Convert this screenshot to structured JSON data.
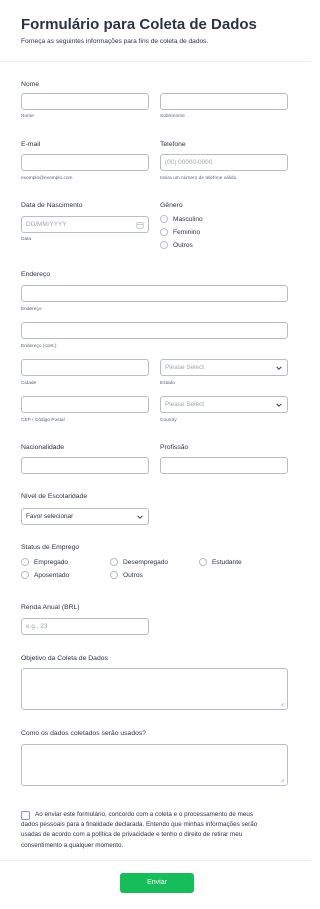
{
  "header": {
    "title": "Formulário para Coleta de Dados",
    "subtitle": "Forneça as seguintes informações para fins de coleta de dados."
  },
  "nome": {
    "label": "Nome",
    "first_sublabel": "Nome",
    "last_sublabel": "Sobrenome"
  },
  "email": {
    "label": "E-mail",
    "sublabel": "exemplo@exemplo.com"
  },
  "telefone": {
    "label": "Telefone",
    "placeholder": "(00) 00000-0000",
    "sublabel": "Insira um número de telefone válido."
  },
  "nascimento": {
    "label": "Data de Nascimento",
    "placeholder": "DD/MM/YYYY",
    "sublabel": "Data"
  },
  "genero": {
    "label": "Gênero",
    "options": [
      "Masculino",
      "Feminino",
      "Outros"
    ]
  },
  "endereco": {
    "label": "Endereço",
    "line1_sublabel": "Endereço",
    "line2_sublabel": "Endereço (cont.)",
    "cidade_sublabel": "Cidade",
    "estado_placeholder": "Please Select",
    "estado_sublabel": "Estado",
    "cep_sublabel": "CEP / Código Postal",
    "country_placeholder": "Please Select",
    "country_sublabel": "Country"
  },
  "nacionalidade": {
    "label": "Nacionalidade"
  },
  "profissao": {
    "label": "Profissão"
  },
  "escolaridade": {
    "label": "Nível de Escolaridade",
    "value": "Favor selecionar"
  },
  "emprego": {
    "label": "Status de Emprego",
    "options": [
      "Empregado",
      "Desempregado",
      "Estudante",
      "Aposentado",
      "Outros"
    ]
  },
  "renda": {
    "label": "Renda Anual (BRL)",
    "placeholder": "e.g., 23"
  },
  "objetivo": {
    "label": "Objetivo da Coleta de Dados"
  },
  "uso": {
    "label": "Como os dados coletados serão usados?"
  },
  "consent": {
    "text": "Ao enviar este formulário, concordo com a coleta e o processamento de meus dados pessoais para a finalidade declarada. Entendo que minhas informações serão usadas de acordo com a política de privacidade e tenho o direito de retirar meu consentimento a qualquer momento."
  },
  "submit": {
    "label": "Enviar"
  },
  "colors": {
    "accent": "#18bd5b",
    "text": "#2c3345",
    "border": "#b8bdc9"
  }
}
